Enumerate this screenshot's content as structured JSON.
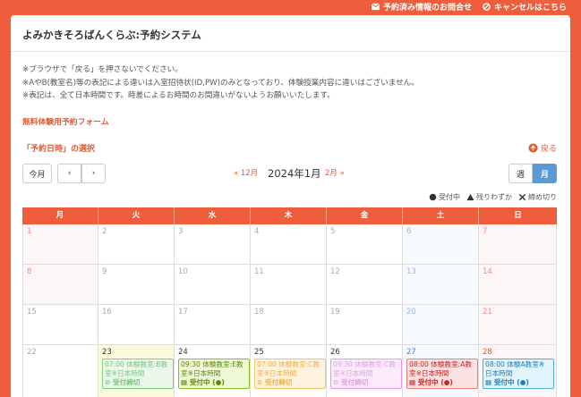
{
  "topbar": {
    "inquiry": "予約済み情報のお問合せ",
    "cancel": "キャンセルはこちら"
  },
  "title": "よみかきそろばんくらぶ:予約システム",
  "notes": [
    "※ブラウザで「戻る」を押さないでください。",
    "※AやB(教室名)等の表記による違いは入室招待状(ID,PW)のみとなっており、体験授業内容に違いはございません。",
    "※表記は、全て日本時間です。時差によるお時間のお間違いがないようお願いいたします。"
  ],
  "free_form": "無料体験用予約フォーム",
  "select_label": "「予約日時」の選択",
  "back": "戻る",
  "buttons": {
    "today": "今月",
    "prev": "‹",
    "next": "›",
    "week": "週",
    "month": "月"
  },
  "nav": {
    "prev": "« 12月",
    "title": "2024年1月",
    "next": "2月 »"
  },
  "legend": {
    "open": "受付中",
    "few": "残りわずか",
    "closed": "締め切り"
  },
  "weekdays": [
    "月",
    "火",
    "水",
    "木",
    "金",
    "土",
    "日"
  ],
  "weeks": [
    [
      "1",
      "2",
      "3",
      "4",
      "5",
      "6",
      "7"
    ],
    [
      "8",
      "9",
      "10",
      "11",
      "12",
      "13",
      "14"
    ],
    [
      "15",
      "16",
      "17",
      "18",
      "19",
      "20",
      "21"
    ],
    [
      "22",
      "23",
      "24",
      "25",
      "26",
      "27",
      "28"
    ]
  ],
  "events": {
    "tue": {
      "line1": "07:00 体験教室:B教",
      "line2": "室※日本時間",
      "status": "受付締切"
    },
    "wed": {
      "line1": "09:30 体験教室:E教",
      "line2": "室※日本時間",
      "status": "受付中 (●)"
    },
    "thu": {
      "line1": "07:00 体験教室:C教",
      "line2": "室※日本時間",
      "status": "受付締切"
    },
    "fri": {
      "line1": "09:30 体験教室:C教",
      "line2": "室※日本時間",
      "status": "受付締切"
    },
    "sat": {
      "line1": "08:00 体験教室:A教",
      "line2": "室※日本時間",
      "status": "受付中 (●)"
    },
    "sun": {
      "line1": "08:00 体験A教室※",
      "line2": "日本時間",
      "status": "受付中 (●)"
    }
  },
  "colors": {
    "accent": "#ee5e3d",
    "blue": "#5b9bd5"
  }
}
